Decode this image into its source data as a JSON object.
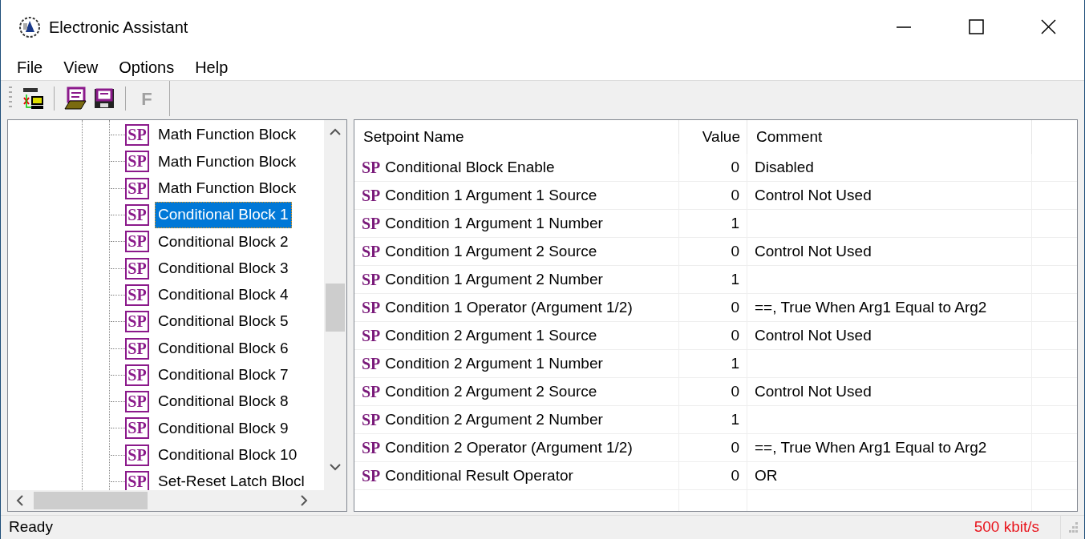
{
  "window": {
    "title": "Electronic Assistant"
  },
  "menu": [
    {
      "label": "File"
    },
    {
      "label": "View"
    },
    {
      "label": "Options"
    },
    {
      "label": "Help"
    }
  ],
  "toolbar": [
    {
      "kind": "can"
    },
    {
      "kind": "separator"
    },
    {
      "kind": "open"
    },
    {
      "kind": "save"
    },
    {
      "kind": "separator"
    },
    {
      "kind": "text",
      "label": "F",
      "disabled": true
    }
  ],
  "tree": {
    "items": [
      {
        "badge": "SP",
        "label": "Math Function Block",
        "selected": false
      },
      {
        "badge": "SP",
        "label": "Math Function Block",
        "selected": false
      },
      {
        "badge": "SP",
        "label": "Math Function Block",
        "selected": false
      },
      {
        "badge": "SP",
        "label": "Conditional Block 1",
        "selected": true
      },
      {
        "badge": "SP",
        "label": "Conditional Block 2",
        "selected": false
      },
      {
        "badge": "SP",
        "label": "Conditional Block 3",
        "selected": false
      },
      {
        "badge": "SP",
        "label": "Conditional Block 4",
        "selected": false
      },
      {
        "badge": "SP",
        "label": "Conditional Block 5",
        "selected": false
      },
      {
        "badge": "SP",
        "label": "Conditional Block 6",
        "selected": false
      },
      {
        "badge": "SP",
        "label": "Conditional Block 7",
        "selected": false
      },
      {
        "badge": "SP",
        "label": "Conditional Block 8",
        "selected": false
      },
      {
        "badge": "SP",
        "label": "Conditional Block 9",
        "selected": false
      },
      {
        "badge": "SP",
        "label": "Conditional Block 10",
        "selected": false
      },
      {
        "badge": "SP",
        "label": "Set-Reset Latch Blocl",
        "selected": false
      }
    ]
  },
  "table": {
    "columns": [
      "Setpoint Name",
      "Value",
      "Comment"
    ],
    "rows": [
      {
        "badge": "SP",
        "name": "Conditional Block Enable",
        "value": "0",
        "comment": "Disabled"
      },
      {
        "badge": "SP",
        "name": "Condition 1 Argument 1 Source",
        "value": "0",
        "comment": "Control Not Used"
      },
      {
        "badge": "SP",
        "name": "Condition 1 Argument 1 Number",
        "value": "1"
      },
      {
        "badge": "SP",
        "name": "Condition 1 Argument 2 Source",
        "value": "0",
        "comment": "Control Not Used"
      },
      {
        "badge": "SP",
        "name": "Condition 1 Argument 2 Number",
        "value": "1"
      },
      {
        "badge": "SP",
        "name": "Condition 1 Operator (Argument 1/2)",
        "value": "0",
        "comment": "==, True When Arg1 Equal to Arg2"
      },
      {
        "badge": "SP",
        "name": "Condition 2 Argument 1 Source",
        "value": "0",
        "comment": "Control Not Used"
      },
      {
        "badge": "SP",
        "name": "Condition 2 Argument 1 Number",
        "value": "1"
      },
      {
        "badge": "SP",
        "name": "Condition 2 Argument 2 Source",
        "value": "0",
        "comment": "Control Not Used"
      },
      {
        "badge": "SP",
        "name": "Condition 2 Argument 2 Number",
        "value": "1"
      },
      {
        "badge": "SP",
        "name": "Condition 2 Operator (Argument 1/2)",
        "value": "0",
        "comment": "==, True When Arg1 Equal to Arg2"
      },
      {
        "badge": "SP",
        "name": "Conditional Result Operator",
        "value": "0",
        "comment": "OR"
      }
    ]
  },
  "status_bar": {
    "message": "Ready",
    "bitrate": "500 kbit/s"
  }
}
